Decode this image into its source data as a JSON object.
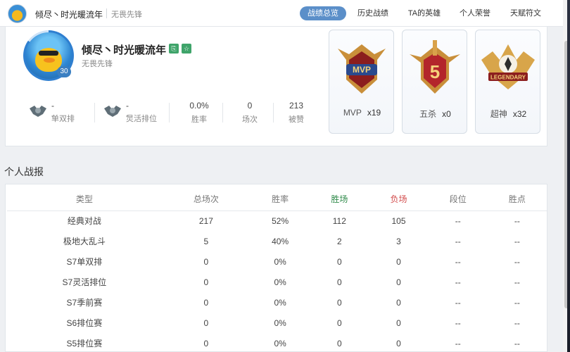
{
  "header": {
    "player_name": "倾尽丶时光暖流年",
    "player_title": "无畏先锋",
    "tabs": [
      {
        "label": "战绩总览",
        "active": true
      },
      {
        "label": "历史战绩",
        "active": false
      },
      {
        "label": "TA的英雄",
        "active": false
      },
      {
        "label": "个人荣誉",
        "active": false
      },
      {
        "label": "天赋符文",
        "active": false
      }
    ],
    "accent_color": "#5b8fc9"
  },
  "profile": {
    "name": "倾尽丶时光暖流年",
    "title": "无畏先锋",
    "level": "30",
    "ranked": [
      {
        "value": "--",
        "label": "单双排"
      },
      {
        "value": "--",
        "label": "灵活排位"
      }
    ],
    "stats": [
      {
        "value": "0.0%",
        "label": "胜率"
      },
      {
        "value": "0",
        "label": "场次"
      },
      {
        "value": "213",
        "label": "被赞"
      }
    ],
    "honors": [
      {
        "name": "MVP",
        "count": "x19",
        "icon": "mvp-badge-icon",
        "badge_text": "MVP"
      },
      {
        "name": "五杀",
        "count": "x0",
        "icon": "pentakill-badge-icon",
        "badge_text": "5"
      },
      {
        "name": "超神",
        "count": "x32",
        "icon": "legendary-badge-icon",
        "badge_text": "LEGENDARY"
      }
    ]
  },
  "report": {
    "title": "个人战报",
    "columns": [
      "类型",
      "总场次",
      "胜率",
      "胜场",
      "负场",
      "段位",
      "胜点"
    ],
    "rows": [
      [
        "经典对战",
        "217",
        "52%",
        "112",
        "105",
        "--",
        "--"
      ],
      [
        "极地大乱斗",
        "5",
        "40%",
        "2",
        "3",
        "--",
        "--"
      ],
      [
        "S7单双排",
        "0",
        "0%",
        "0",
        "0",
        "--",
        "--"
      ],
      [
        "S7灵活排位",
        "0",
        "0%",
        "0",
        "0",
        "--",
        "--"
      ],
      [
        "S7季前赛",
        "0",
        "0%",
        "0",
        "0",
        "--",
        "--"
      ],
      [
        "S6排位赛",
        "0",
        "0%",
        "0",
        "0",
        "--",
        "--"
      ],
      [
        "S5排位赛",
        "0",
        "0%",
        "0",
        "0",
        "--",
        "--"
      ]
    ]
  }
}
